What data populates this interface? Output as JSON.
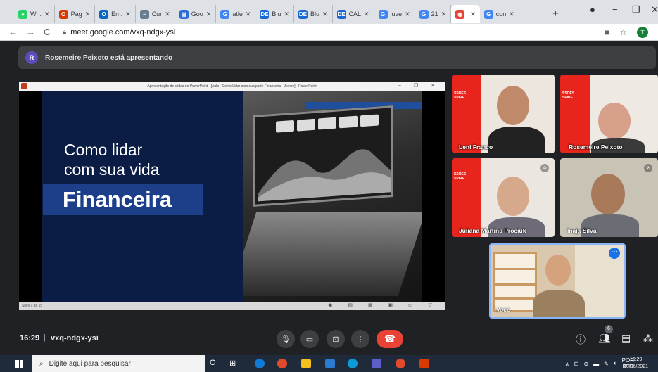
{
  "browser": {
    "tabs": [
      {
        "label": "Wh:",
        "icon": "whatsapp-icon",
        "color": "#25d366",
        "glyph": "●"
      },
      {
        "label": "Pág",
        "icon": "office-icon",
        "color": "#d83b01",
        "glyph": "O"
      },
      {
        "label": "Em:",
        "icon": "outlook-icon",
        "color": "#0a64c2",
        "glyph": "O"
      },
      {
        "label": "Cur",
        "icon": "course-icon",
        "color": "#6a7d8f",
        "glyph": "≡"
      },
      {
        "label": "Goo",
        "icon": "google-docs-icon",
        "color": "#2a6cd8",
        "glyph": "▤"
      },
      {
        "label": "atle",
        "icon": "google-icon",
        "color": "#4285f4",
        "glyph": "G"
      },
      {
        "label": "Blu",
        "icon": "de-icon",
        "color": "#1967d2",
        "glyph": "DE"
      },
      {
        "label": "Blu",
        "icon": "de-icon",
        "color": "#1967d2",
        "glyph": "DE"
      },
      {
        "label": "CAL",
        "icon": "de-icon",
        "color": "#1967d2",
        "glyph": "DE"
      },
      {
        "label": "luve",
        "icon": "google-icon",
        "color": "#4285f4",
        "glyph": "G"
      },
      {
        "label": "21",
        "icon": "google-icon",
        "color": "#4285f4",
        "glyph": "G"
      },
      {
        "label": "",
        "icon": "meet-recording-icon",
        "color": "#ea4335",
        "glyph": "◉",
        "active": true
      },
      {
        "label": "con",
        "icon": "google-icon",
        "color": "#4285f4",
        "glyph": "G"
      }
    ],
    "url": "meet.google.com/vxq-ndgx-ysi",
    "profile_initial": "T"
  },
  "meet": {
    "presenter_initial": "R",
    "presenter_text": "Rosemeire Peixoto está apresentando",
    "presentation": {
      "window_title": "Apresentação de slides do PowerPoint - [Aula - Como Lidar com sua parte Financeira - Jovem] - PowerPoint",
      "slide_line1": "Como lidar",
      "slide_line2": "com sua vida",
      "slide_line3": "Financeira",
      "slide_counter": "Slide 1 de 15"
    },
    "participants": [
      {
        "name": "Leni Franco"
      },
      {
        "name": "Rosemeire Peixoto"
      },
      {
        "name": "Juliana Martins Prociuk"
      },
      {
        "name": "Inaja Silva"
      }
    ],
    "self_label": "Você",
    "meeting_time": "16:29",
    "meeting_code": "vxq-ndgx-ysi",
    "people_count": "6"
  },
  "taskbar": {
    "search_placeholder": "Digite aqui para pesquisar",
    "language_top": "POR",
    "language_bottom": "PTB",
    "time": "16:29",
    "date": "10/06/2021"
  }
}
